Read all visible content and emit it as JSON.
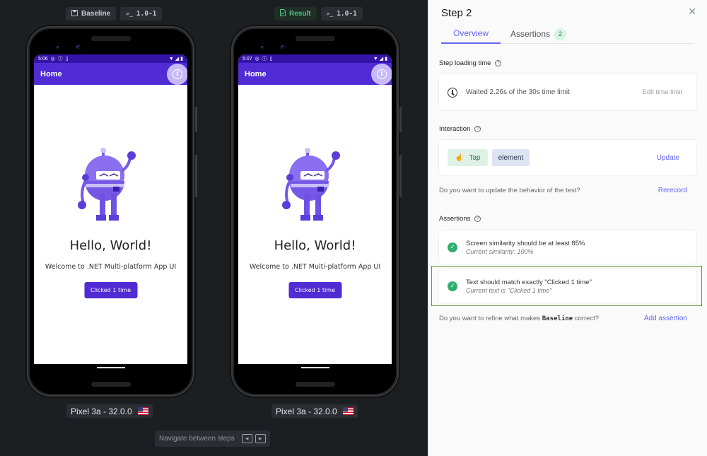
{
  "viewer": {
    "baseline_tag": {
      "label": "Baseline",
      "icon": "save-icon"
    },
    "baseline_version": {
      "prefix": ">_",
      "label": "1.0-1"
    },
    "result_tag": {
      "label": "Result",
      "icon": "document-check-icon"
    },
    "result_version": {
      "prefix": ">_",
      "label": "1.0-1"
    },
    "devices": [
      {
        "name": "baseline",
        "status_time": "5:06",
        "appbar_title": "Home",
        "hello": "Hello, World!",
        "welcome": "Welcome to .NET Multi-platform App UI",
        "button": "Clicked 1 time",
        "label": "Pixel 3a - 32.0.0"
      },
      {
        "name": "result",
        "status_time": "5:07",
        "appbar_title": "Home",
        "hello": "Hello, World!",
        "welcome": "Welcome to .NET Multi-platform App UI",
        "button": "Clicked 1 time",
        "label": "Pixel 3a - 32.0.0"
      }
    ],
    "navigate": {
      "label": "Navigate between steps",
      "prev": "◀",
      "next": "▶"
    }
  },
  "panel": {
    "title": "Step 2",
    "close": "✕",
    "tabs": [
      {
        "label": "Overview",
        "active": true
      },
      {
        "label": "Assertions",
        "badge": "2",
        "active": false
      }
    ],
    "loading": {
      "label": "Step loading time",
      "text": "Waited 2.26s of the 30s time limit",
      "action": "Edit time limit"
    },
    "interaction": {
      "label": "Interaction",
      "action_type": "Tap",
      "target": "element",
      "update": "Update",
      "note": "Do you want to update the behavior of the test?",
      "rerecord": "Rerecord"
    },
    "assertions": {
      "label": "Assertions",
      "items": [
        {
          "title": "Screen similarity should be at least 85%",
          "subtitle": "Current similarity: 100%",
          "status": "passed"
        },
        {
          "title": "Text should match exactly \"Clicked 1 time\"",
          "subtitle": "Current text is \"Clicked 1 time\"",
          "status": "passed"
        }
      ],
      "note_prefix": "Do you want to refine what makes ",
      "note_code": "Baseline",
      "note_suffix": " correct?",
      "add": "Add assertion"
    }
  },
  "colors": {
    "accent": "#6366f1",
    "maui_purple": "#512bd4",
    "success": "#2fae6e",
    "highlight_border": "#5f9a35"
  }
}
